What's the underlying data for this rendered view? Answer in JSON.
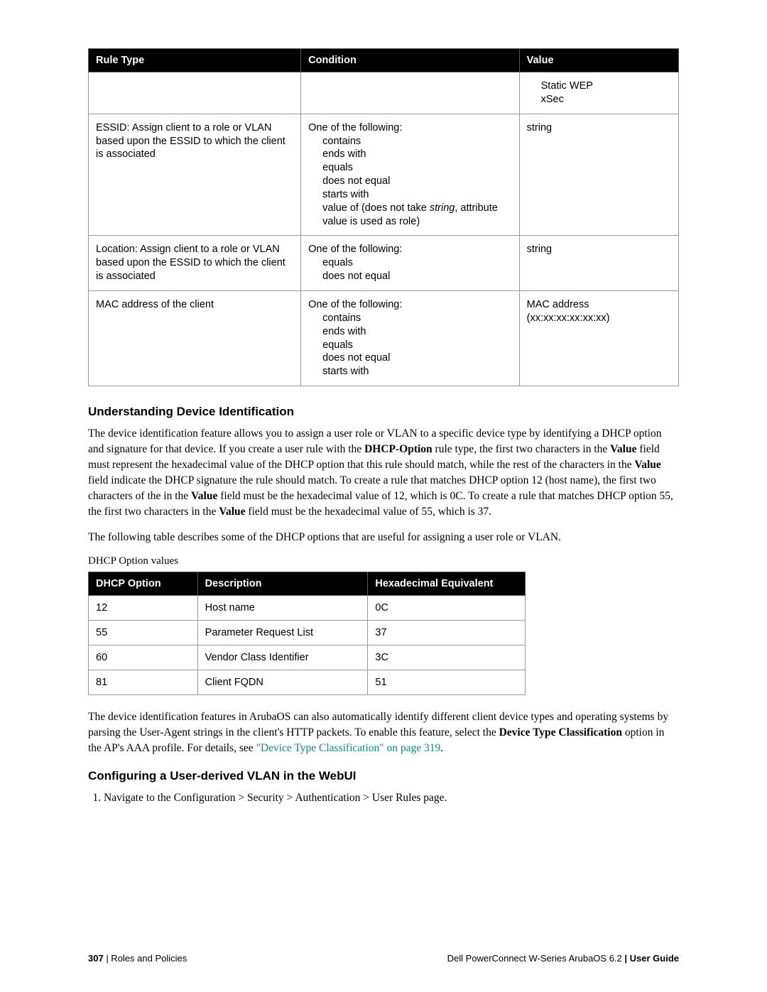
{
  "table1": {
    "headers": {
      "c1": "Rule Type",
      "c2": "Condition",
      "c3": "Value"
    },
    "rows": [
      {
        "rule": "",
        "cond": "",
        "value_lines": [
          "Static WEP",
          "xSec"
        ]
      },
      {
        "rule": "ESSID: Assign client to a role or VLAN based upon the ESSID to which the client is associated",
        "cond_head": "One of the following:",
        "cond_items_pre": [
          "contains",
          "ends with",
          "equals",
          "does not equal",
          "starts with"
        ],
        "cond_special_prefix": "value of (does not take ",
        "cond_special_italic": "string",
        "cond_special_suffix": ", attribute value is used as role)",
        "value": "string"
      },
      {
        "rule": "Location: Assign client to a role or VLAN based upon the ESSID to which the client is associated",
        "cond_head": "One of the following:",
        "cond_items": [
          "equals",
          "does not equal"
        ],
        "value": "string"
      },
      {
        "rule": "MAC address of the client",
        "cond_head": "One of the following:",
        "cond_items": [
          "contains",
          "ends with",
          "equals",
          "does not equal",
          "starts with"
        ],
        "value": "MAC address (xx:xx:xx:xx:xx:xx)"
      }
    ]
  },
  "section1": {
    "title": "Understanding Device Identification",
    "p1_parts": {
      "t1": "The device identification feature allows you to assign a user role or VLAN to a specific device type by identifying a DHCP option and signature for that device. If you create a user rule with the ",
      "b1": "DHCP-Option",
      "t2": " rule type, the first two characters in the ",
      "b2": "Value",
      "t3": " field must represent the hexadecimal value of the DHCP option that this rule should match, while the rest of the characters in the ",
      "b3": "Value",
      "t4": " field indicate the DHCP signature the rule should match. To create a rule that matches DHCP option 12 (host name), the first two characters of the in the ",
      "b4": "Value",
      "t5": " field must be the hexadecimal value of 12, which is 0C. To create a rule that matches DHCP option 55, the first two characters in the ",
      "b5": "Value",
      "t6": " field must be the hexadecimal value of 55, which is 37."
    },
    "p2": "The following table describes some of the DHCP options that are useful for assigning a user role or VLAN.",
    "caption": "DHCP Option values"
  },
  "table2": {
    "headers": {
      "c1": "DHCP Option",
      "c2": "Description",
      "c3": "Hexadecimal Equivalent"
    },
    "rows": [
      {
        "opt": "12",
        "desc": "Host name",
        "hex": "0C"
      },
      {
        "opt": "55",
        "desc": "Parameter Request List",
        "hex": "37"
      },
      {
        "opt": "60",
        "desc": "Vendor Class Identifier",
        "hex": "3C"
      },
      {
        "opt": "81",
        "desc": "Client FQDN",
        "hex": "51"
      }
    ]
  },
  "section2": {
    "p_parts": {
      "t1": "The device identification features in ArubaOS can also automatically identify different client device types and operating systems by parsing the User-Agent strings in the client's HTTP packets. To enable this feature, select the ",
      "b1": "Device Type Classification",
      "t2": " option in the AP's AAA profile. For details, see ",
      "link": "\"Device Type Classification\" on page 319",
      "t3": "."
    }
  },
  "section3": {
    "title": "Configuring a User-derived VLAN in the WebUI",
    "step1": {
      "t1": "Navigate to the ",
      "b1": "Configuration > Security > Authentication > User Rules",
      "t2": " page."
    }
  },
  "footer": {
    "page_num": "307",
    "left_text": " | Roles and Policies",
    "right_prefix": "Dell PowerConnect W-Series ArubaOS 6.2 ",
    "right_suffix": "|  User Guide"
  }
}
